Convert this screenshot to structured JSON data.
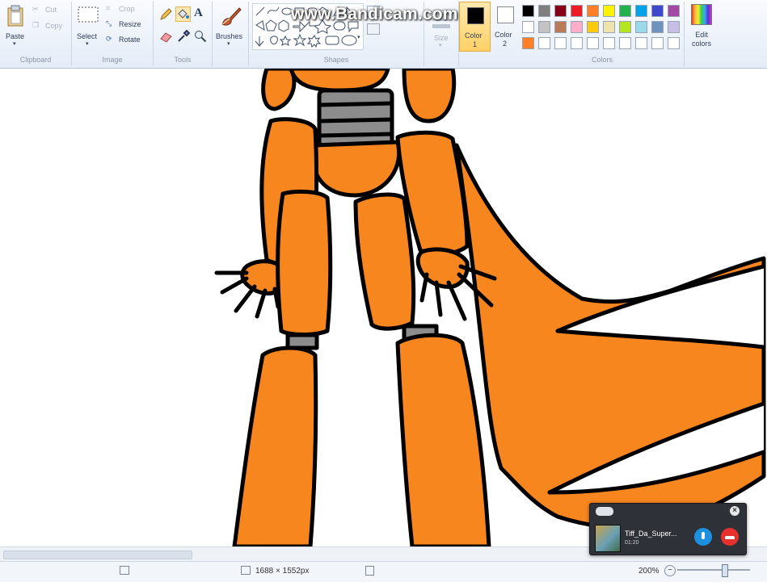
{
  "watermark": "www.Bandicam.com",
  "clipboard": {
    "paste": "Paste",
    "cut": "Cut",
    "copy": "Copy",
    "label": "Clipboard"
  },
  "image": {
    "select": "Select",
    "crop": "Crop",
    "resize": "Resize",
    "rotate": "Rotate",
    "label": "Image"
  },
  "tools": {
    "label": "Tools"
  },
  "brushes": {
    "label": "Brushes"
  },
  "shapes": {
    "label": "Shapes"
  },
  "size": {
    "label": "Size"
  },
  "color1": {
    "label": "Color",
    "num": "1"
  },
  "color2": {
    "label": "Color",
    "num": "2"
  },
  "colors": {
    "label": "Colors",
    "edit_label": "Edit colors",
    "color1_value": "#000000",
    "color2_value": "#ffffff",
    "row1": [
      "#000000",
      "#7f7f7f",
      "#880015",
      "#ed1c24",
      "#ff7f27",
      "#fff200",
      "#22b14c",
      "#00a2e8",
      "#3f48cc",
      "#a349a4"
    ],
    "row2": [
      "#ffffff",
      "#c3c3c3",
      "#b97a57",
      "#ffaec9",
      "#ffc90e",
      "#efe4b0",
      "#b5e61d",
      "#99d9ea",
      "#7092be",
      "#c8bfe7"
    ],
    "row3": [
      "#ff7f27",
      "#ffffff",
      "#ffffff",
      "#ffffff",
      "#ffffff",
      "#ffffff",
      "#ffffff",
      "#ffffff",
      "#ffffff",
      "#ffffff"
    ]
  },
  "status": {
    "dimensions": "1688 × 1552px",
    "zoom": "200%"
  },
  "notification": {
    "title": "Tiff_Da_Super...",
    "time": "01:20"
  }
}
